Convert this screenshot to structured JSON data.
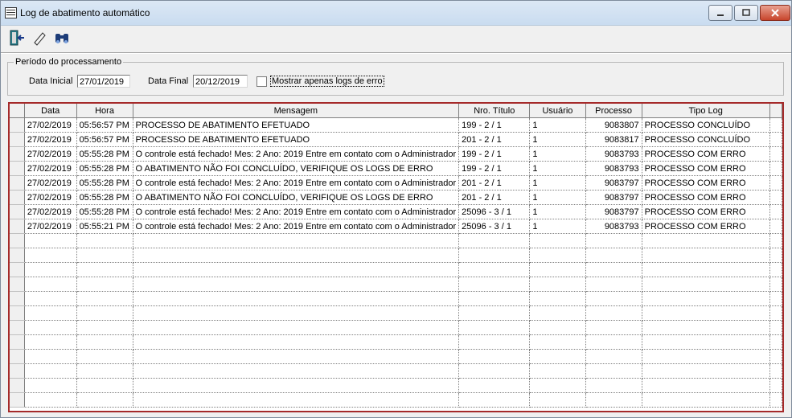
{
  "window": {
    "title": "Log de abatimento automático"
  },
  "toolbar": {
    "exit_icon": "door-exit-icon",
    "clear_icon": "eraser-icon",
    "search_icon": "binoculars-icon"
  },
  "filter": {
    "group_label": "Período do processamento",
    "start_label": "Data Inicial",
    "start_value": "27/01/2019",
    "end_label": "Data Final",
    "end_value": "20/12/2019",
    "errors_only_label": "Mostrar apenas logs de erro",
    "errors_only_checked": false
  },
  "grid": {
    "columns": [
      "Data",
      "Hora",
      "Mensagem",
      "Nro. Título",
      "Usuário",
      "Processo",
      "Tipo Log"
    ],
    "rows": [
      [
        "27/02/2019",
        "05:56:57 PM",
        "PROCESSO DE ABATIMENTO EFETUADO",
        "199 - 2 / 1",
        "1",
        "9083807",
        "PROCESSO CONCLUÍDO"
      ],
      [
        "27/02/2019",
        "05:56:57 PM",
        "PROCESSO DE ABATIMENTO EFETUADO",
        "201 - 2 / 1",
        "1",
        "9083817",
        "PROCESSO CONCLUÍDO"
      ],
      [
        "27/02/2019",
        "05:55:28 PM",
        " O controle está fechado! Mes: 2 Ano: 2019 Entre em contato com o Administrador",
        "199 - 2 / 1",
        "1",
        "9083793",
        "PROCESSO COM ERRO"
      ],
      [
        "27/02/2019",
        "05:55:28 PM",
        "O ABATIMENTO NÃO FOI CONCLUÍDO, VERIFIQUE OS LOGS DE ERRO",
        "199 - 2 / 1",
        "1",
        "9083793",
        "PROCESSO COM ERRO"
      ],
      [
        "27/02/2019",
        "05:55:28 PM",
        " O controle está fechado! Mes: 2 Ano: 2019 Entre em contato com o Administrador",
        "201 - 2 / 1",
        "1",
        "9083797",
        "PROCESSO COM ERRO"
      ],
      [
        "27/02/2019",
        "05:55:28 PM",
        "O ABATIMENTO NÃO FOI CONCLUÍDO, VERIFIQUE OS LOGS DE ERRO",
        "201 - 2 / 1",
        "1",
        "9083797",
        "PROCESSO COM ERRO"
      ],
      [
        "27/02/2019",
        "05:55:28 PM",
        " O controle está fechado! Mes: 2 Ano: 2019 Entre em contato com o Administrador",
        "25096 - 3 / 1",
        "1",
        "9083797",
        "PROCESSO COM ERRO"
      ],
      [
        "27/02/2019",
        "05:55:21 PM",
        " O controle está fechado! Mes: 2 Ano: 2019 Entre em contato com o Administrador",
        "25096 - 3 / 1",
        "1",
        "9083793",
        "PROCESSO COM ERRO"
      ]
    ],
    "empty_rows": 12
  }
}
